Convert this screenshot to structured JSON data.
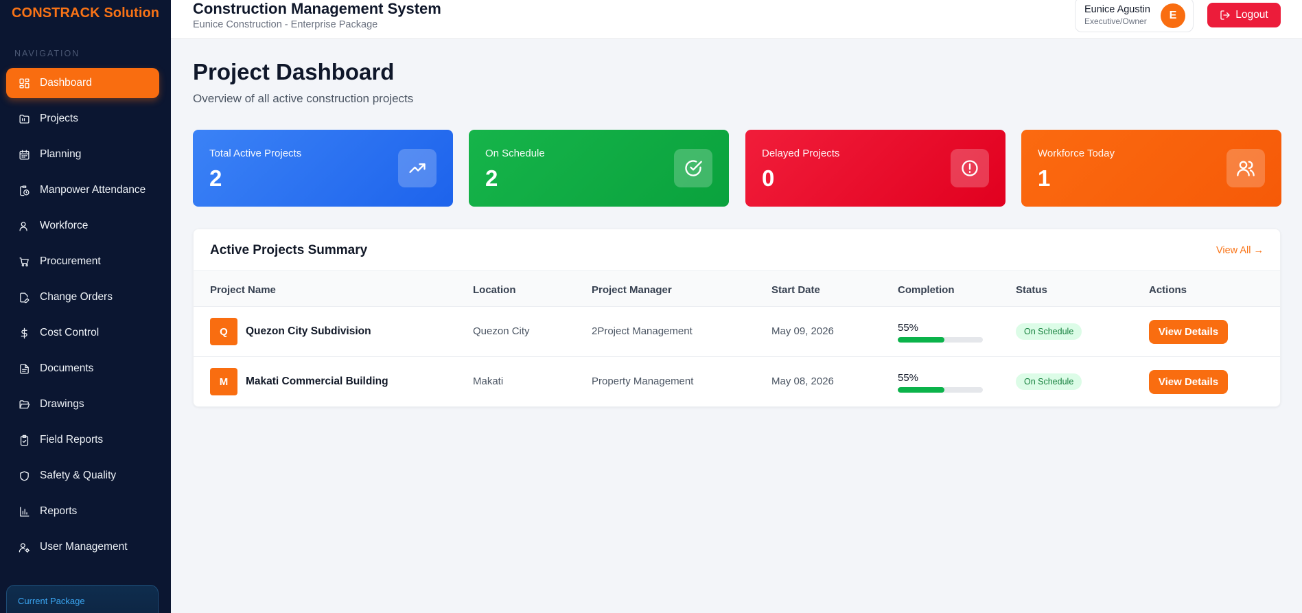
{
  "sidebar": {
    "brand": "CONSTRACK Solution",
    "heading": "NAVIGATION",
    "items": [
      {
        "label": "Dashboard",
        "icon": "dashboard-icon",
        "active": true
      },
      {
        "label": "Projects",
        "icon": "folder-icon"
      },
      {
        "label": "Planning",
        "icon": "calendar-icon"
      },
      {
        "label": "Manpower Attendance",
        "icon": "clipboard-clock-icon"
      },
      {
        "label": "Workforce",
        "icon": "user-icon"
      },
      {
        "label": "Procurement",
        "icon": "cart-icon"
      },
      {
        "label": "Change Orders",
        "icon": "file-edit-icon"
      },
      {
        "label": "Cost Control",
        "icon": "dollar-icon"
      },
      {
        "label": "Documents",
        "icon": "document-icon"
      },
      {
        "label": "Drawings",
        "icon": "folder-open-icon"
      },
      {
        "label": "Field Reports",
        "icon": "clipboard-check-icon"
      },
      {
        "label": "Safety & Quality",
        "icon": "shield-icon"
      },
      {
        "label": "Reports",
        "icon": "bar-chart-icon"
      },
      {
        "label": "User Management",
        "icon": "user-gear-icon"
      }
    ],
    "package_label": "Current Package"
  },
  "header": {
    "title": "Construction Management System",
    "subtitle": "Eunice Construction - Enterprise Package",
    "user_name": "Eunice Agustin",
    "user_role": "Executive/Owner",
    "avatar_initial": "E",
    "logout_label": "Logout"
  },
  "main": {
    "title": "Project Dashboard",
    "subtitle": "Overview of all active construction projects",
    "cards": [
      {
        "label": "Total Active Projects",
        "value": "2",
        "icon": "trending-up-icon",
        "color": "#2f75f2"
      },
      {
        "label": "On Schedule",
        "value": "2",
        "icon": "check-circle-icon",
        "color": "#10ac44"
      },
      {
        "label": "Delayed Projects",
        "value": "0",
        "icon": "alert-circle-icon",
        "color": "#ec0f2d"
      },
      {
        "label": "Workforce Today",
        "value": "1",
        "icon": "users-icon",
        "color": "#f96310"
      }
    ],
    "table": {
      "title": "Active Projects Summary",
      "view_all": "View All →",
      "columns": [
        "Project Name",
        "Location",
        "Project Manager",
        "Start Date",
        "Completion",
        "Status",
        "Actions"
      ],
      "rows": [
        {
          "initial": "Q",
          "name": "Quezon City Subdivision",
          "location": "Quezon City",
          "manager": "2Project Management",
          "start": "May 09, 2026",
          "completion": "55%",
          "completion_value": 0.55,
          "status": "On Schedule",
          "action": "View Details"
        },
        {
          "initial": "M",
          "name": "Makati Commercial Building",
          "location": "Makati",
          "manager": "Property Management",
          "start": "May 08, 2026",
          "completion": "55%",
          "completion_value": 0.55,
          "status": "On Schedule",
          "action": "View Details"
        }
      ]
    }
  },
  "colors": {
    "accent": "#f96d10",
    "sidebar_bg": "#0b1631",
    "logout": "#ec1c3a",
    "progress": "#0bb34a"
  }
}
